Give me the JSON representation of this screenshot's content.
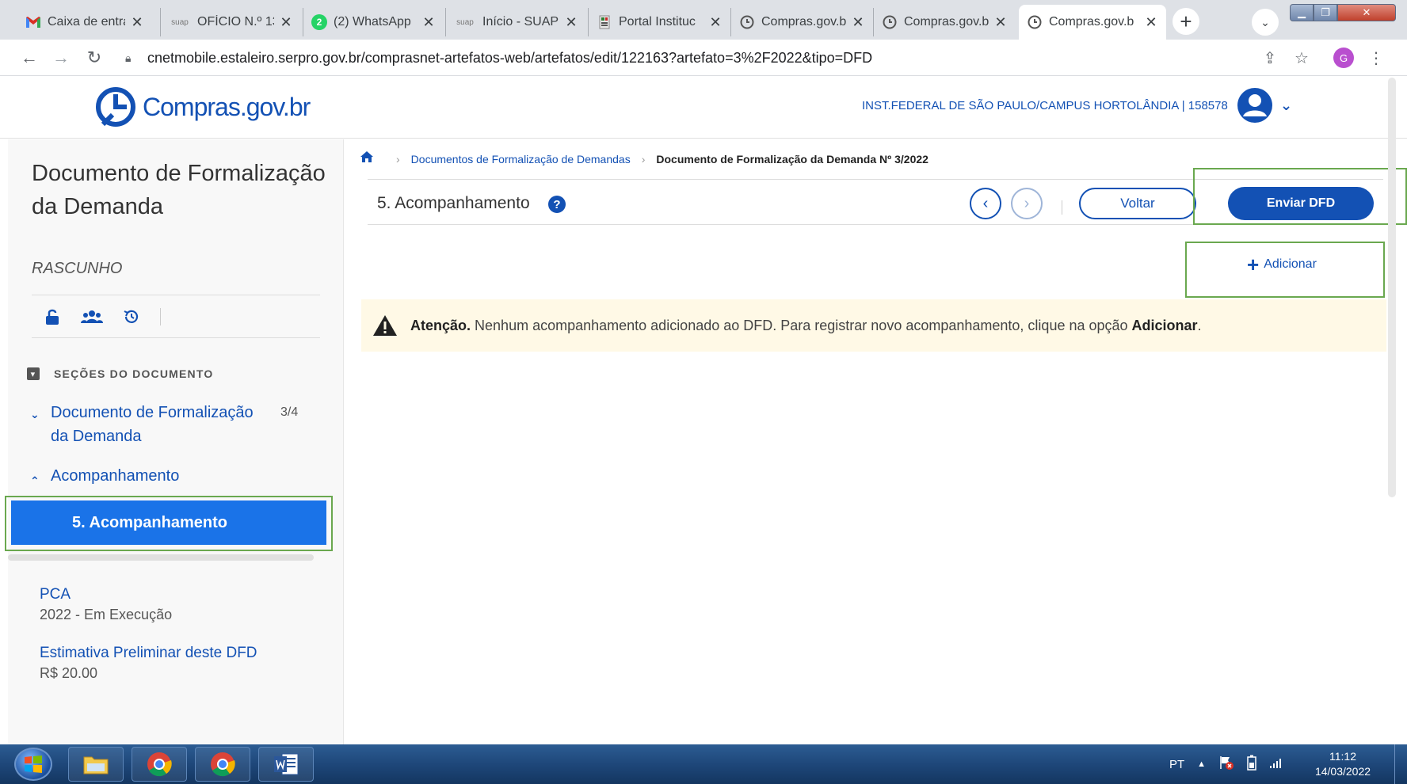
{
  "browser": {
    "tabs": [
      {
        "title": "Caixa de entra",
        "icon": "gmail-icon"
      },
      {
        "title": "OFÍCIO N.º 13",
        "icon": "suap-icon",
        "icon_text": "suap"
      },
      {
        "title": "(2) WhatsApp",
        "icon": "whatsapp-icon",
        "icon_text": "2"
      },
      {
        "title": "Início - SUAP",
        "icon": "suap-icon",
        "icon_text": "suap"
      },
      {
        "title": "Portal Instituc",
        "icon": "portal-icon"
      },
      {
        "title": "Compras.gov.b",
        "icon": "compras-icon"
      },
      {
        "title": "Compras.gov.b",
        "icon": "compras-icon"
      },
      {
        "title": "Compras.gov.b",
        "icon": "compras-icon",
        "active": true
      }
    ],
    "url": "cnetmobile.estaleiro.serpro.gov.br/comprasnet-artefatos-web/artefatos/edit/122163?artefato=3%2F2022&tipo=DFD",
    "profile_initial": "G"
  },
  "header": {
    "logo_text": "Compras.gov.br",
    "org_name": "INST.FEDERAL DE SÃO PAULO/CAMPUS HORTOLÂNDIA | 158578"
  },
  "sidebar": {
    "doc_title": "Documento de Formalização da Demanda",
    "doc_status": "RASCUNHO",
    "sections_header": "SEÇÕES DO DOCUMENTO",
    "sections": [
      {
        "label": "Documento de Formalização da Demanda",
        "count": "3/4",
        "expanded": false
      },
      {
        "label": "Acompanhamento",
        "expanded": true
      }
    ],
    "active_step": "5.  Acompanhamento",
    "info": [
      {
        "label": "PCA",
        "value": "2022 - Em Execução"
      },
      {
        "label": "Estimativa Preliminar deste DFD",
        "value": "R$ 20.00"
      }
    ]
  },
  "breadcrumb": {
    "items": [
      "Documentos de Formalização de Demandas",
      "Documento de Formalização da Demanda Nº 3/2022"
    ]
  },
  "main": {
    "step_title": "5. Acompanhamento",
    "help_glyph": "?",
    "voltar_label": "Voltar",
    "enviar_label": "Enviar DFD",
    "adicionar_label": "Adicionar",
    "alert": {
      "strong": "Atenção.",
      "text": " Nenhum acompanhamento adicionado ao DFD. Para registrar novo acompanhamento, clique na opção ",
      "action": "Adicionar",
      "end": "."
    }
  },
  "taskbar": {
    "language": "PT",
    "time": "11:12",
    "date": "14/03/2022"
  },
  "colors": {
    "brand": "#1351b4",
    "active_step_bg": "#1a73e8",
    "alert_bg": "#fff9e6",
    "highlight_outline": "#6aa84f"
  }
}
